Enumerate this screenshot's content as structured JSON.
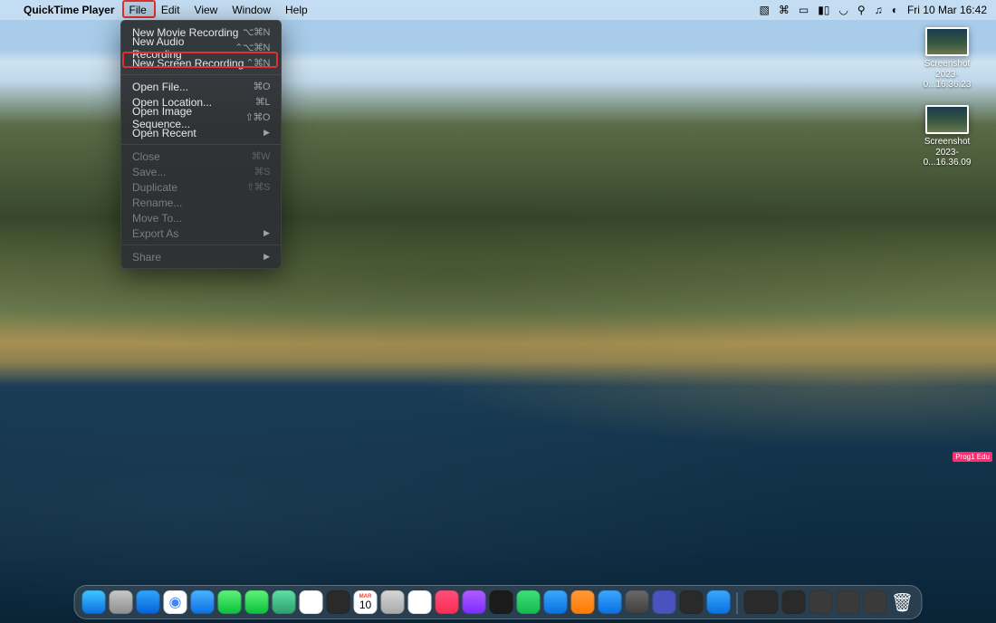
{
  "menubar": {
    "app_name": "QuickTime Player",
    "items": [
      "File",
      "Edit",
      "View",
      "Window",
      "Help"
    ],
    "datetime": "Fri 10 Mar  16:42",
    "status_icons": [
      "camera-off-icon",
      "bluetooth-icon",
      "video-icon",
      "battery-icon",
      "wifi-icon",
      "search-icon",
      "audio-icon",
      "control-center-icon"
    ]
  },
  "file_menu": {
    "groups": [
      [
        {
          "label": "New Movie Recording",
          "shortcut": "⌥⌘N",
          "enabled": true,
          "arrow": false
        },
        {
          "label": "New Audio Recording",
          "shortcut": "⌃⌥⌘N",
          "enabled": true,
          "arrow": false
        },
        {
          "label": "New Screen Recording",
          "shortcut": "⌃⌘N",
          "enabled": true,
          "arrow": false
        }
      ],
      [
        {
          "label": "Open File...",
          "shortcut": "⌘O",
          "enabled": true,
          "arrow": false
        },
        {
          "label": "Open Location...",
          "shortcut": "⌘L",
          "enabled": true,
          "arrow": false
        },
        {
          "label": "Open Image Sequence...",
          "shortcut": "⇧⌘O",
          "enabled": true,
          "arrow": false
        },
        {
          "label": "Open Recent",
          "shortcut": "",
          "enabled": true,
          "arrow": true
        }
      ],
      [
        {
          "label": "Close",
          "shortcut": "⌘W",
          "enabled": false,
          "arrow": false
        },
        {
          "label": "Save...",
          "shortcut": "⌘S",
          "enabled": false,
          "arrow": false
        },
        {
          "label": "Duplicate",
          "shortcut": "⇧⌘S",
          "enabled": false,
          "arrow": false
        },
        {
          "label": "Rename...",
          "shortcut": "",
          "enabled": false,
          "arrow": false
        },
        {
          "label": "Move To...",
          "shortcut": "",
          "enabled": false,
          "arrow": false
        },
        {
          "label": "Export As",
          "shortcut": "",
          "enabled": false,
          "arrow": true
        }
      ],
      [
        {
          "label": "Share",
          "shortcut": "",
          "enabled": false,
          "arrow": true
        }
      ]
    ]
  },
  "desktop": {
    "icons": [
      {
        "line1": "Screenshot",
        "line2": "2023-0...16.36.23"
      },
      {
        "line1": "Screenshot",
        "line2": "2023-0...16.36.09"
      }
    ]
  },
  "pink_badge": "Prog1 Edu",
  "dock": {
    "calendar_day": "10",
    "calendar_month": "MAR",
    "apps": [
      {
        "name": "finder",
        "color": "linear-gradient(#3ec7ff,#0a6fe0)"
      },
      {
        "name": "launchpad",
        "color": "linear-gradient(#c8c8c8,#8d8d8d)"
      },
      {
        "name": "safari",
        "color": "linear-gradient(#2ea7ff,#0560d6)"
      },
      {
        "name": "chrome",
        "color": "#fff"
      },
      {
        "name": "mail",
        "color": "linear-gradient(#4ab3ff,#0b6fe2)"
      },
      {
        "name": "facetime",
        "color": "linear-gradient(#5ef27a,#0bbf3a)"
      },
      {
        "name": "messages",
        "color": "linear-gradient(#5ef27a,#0bbf3a)"
      },
      {
        "name": "maps",
        "color": "linear-gradient(#5fe0a3,#2d9e6f)"
      },
      {
        "name": "photos",
        "color": "#fff"
      },
      {
        "name": "screenshot",
        "color": "#2a2a2a"
      },
      {
        "name": "calendar",
        "color": "#fff"
      },
      {
        "name": "contacts",
        "color": "linear-gradient(#d7d7d7,#a8a8a8)"
      },
      {
        "name": "reminders",
        "color": "#fff"
      },
      {
        "name": "music",
        "color": "linear-gradient(#ff4f7b,#fa2d55)"
      },
      {
        "name": "podcasts",
        "color": "linear-gradient(#b25cff,#7a2cff)"
      },
      {
        "name": "appletv",
        "color": "#1b1b1b"
      },
      {
        "name": "numbers",
        "color": "linear-gradient(#3fe07a,#15b84e)"
      },
      {
        "name": "keynote",
        "color": "linear-gradient(#3aa8ff,#0a6fe0)"
      },
      {
        "name": "pages",
        "color": "linear-gradient(#ff9a3c,#ff7a00)"
      },
      {
        "name": "appstore",
        "color": "linear-gradient(#3aa8ff,#0a6fe0)"
      },
      {
        "name": "preferences",
        "color": "linear-gradient(#6a6a6a,#3e3e3e)"
      },
      {
        "name": "teams",
        "color": "#4a52bd"
      },
      {
        "name": "screenshot2",
        "color": "#2a2a2a"
      },
      {
        "name": "preview",
        "color": "linear-gradient(#3aa8ff,#0a6fe0)"
      }
    ],
    "right_apps": [
      {
        "name": "keyboard-pref",
        "color": "#2a2a2a"
      },
      {
        "name": "misc1",
        "color": "#2a2a2a"
      },
      {
        "name": "misc2",
        "color": "#3a3a3a"
      },
      {
        "name": "misc3",
        "color": "#3a3a3a"
      },
      {
        "name": "misc4",
        "color": "#3a3a3a"
      },
      {
        "name": "trash",
        "color": "linear-gradient(#d0d4d9,#9aa0a7)"
      }
    ]
  }
}
